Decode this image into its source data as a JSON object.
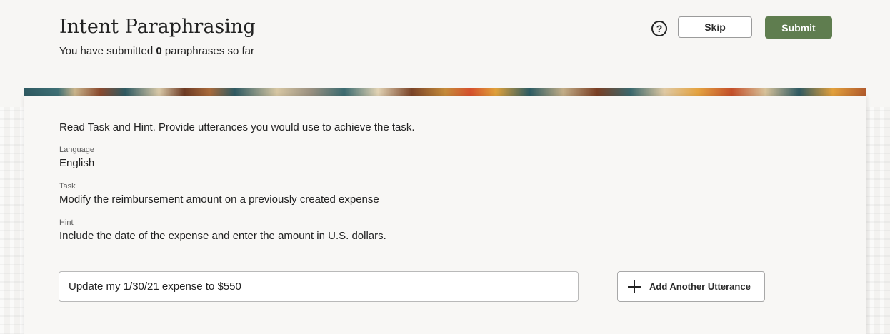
{
  "header": {
    "title": "Intent Paraphrasing",
    "subtitle_prefix": "You have submitted ",
    "submitted_count": "0",
    "subtitle_suffix": " paraphrases so far",
    "help_icon": "?",
    "skip_label": "Skip",
    "submit_label": "Submit"
  },
  "colors": {
    "submit_bg": "#5f7d4f"
  },
  "form": {
    "instructions": "Read Task and Hint. Provide utterances you would use to achieve the task.",
    "language_label": "Language",
    "language_value": "English",
    "task_label": "Task",
    "task_value": "Modify the reimbursement amount on a previously created expense",
    "hint_label": "Hint",
    "hint_value": "Include the date of the expense and enter the amount in U.S. dollars.",
    "utterance_value": "Update my 1/30/21 expense to $550",
    "add_button_label": "Add Another Utterance",
    "add_icon": "plus-icon"
  }
}
